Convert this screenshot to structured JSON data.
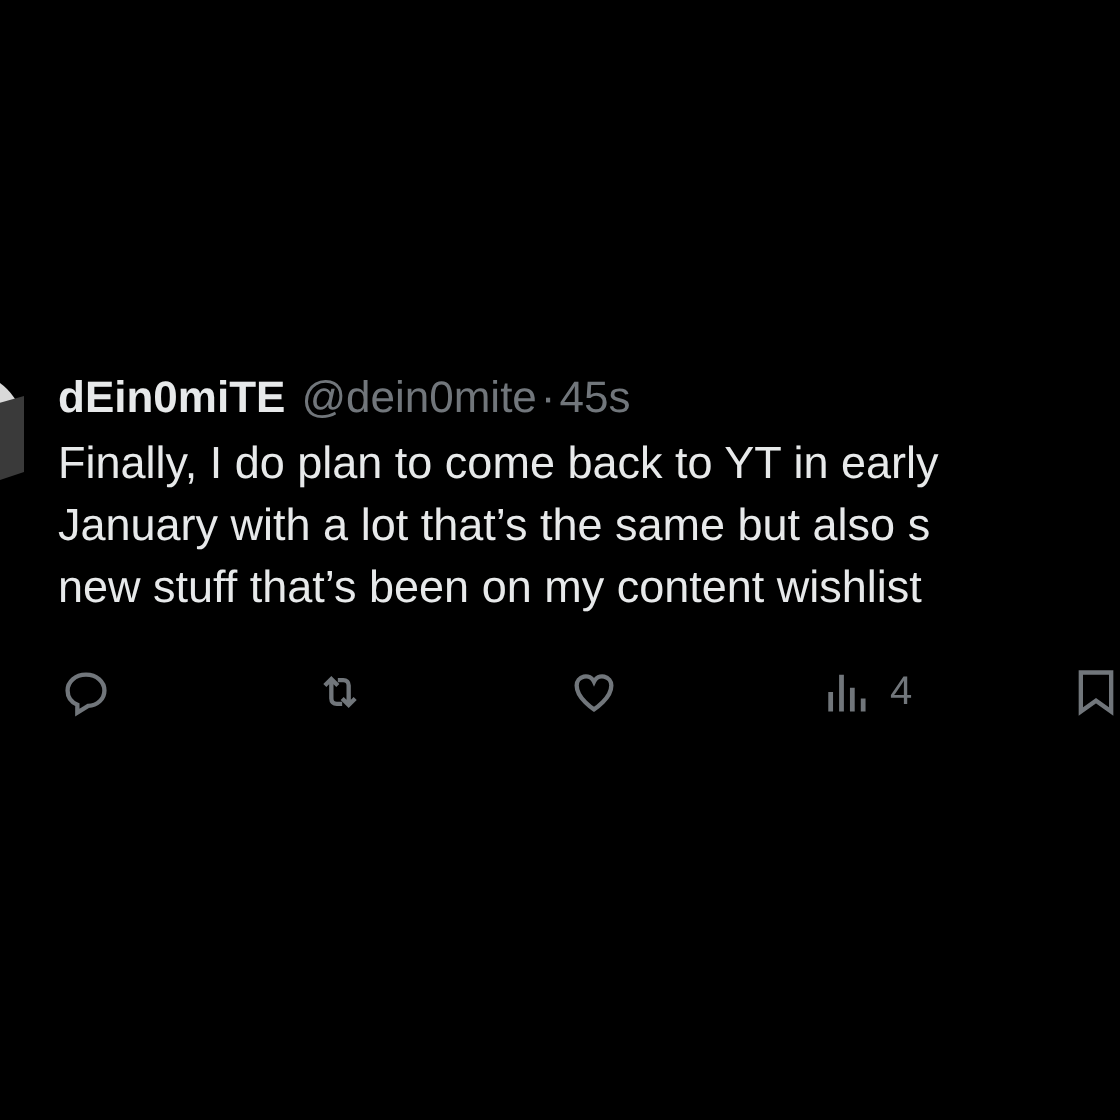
{
  "post": {
    "display_name": "dEin0miTE",
    "handle": "@dein0mite",
    "separator": "·",
    "time": "45s",
    "lines": [
      "Finally, I do plan to come back to YT in early",
      "January with a lot that’s the same but also s",
      "new stuff that’s been on my content wishlist"
    ]
  },
  "actions": [
    {
      "kind": "reply"
    },
    {
      "kind": "repost"
    },
    {
      "kind": "like"
    },
    {
      "kind": "views",
      "count": "4"
    },
    {
      "kind": "bookmark"
    }
  ]
}
